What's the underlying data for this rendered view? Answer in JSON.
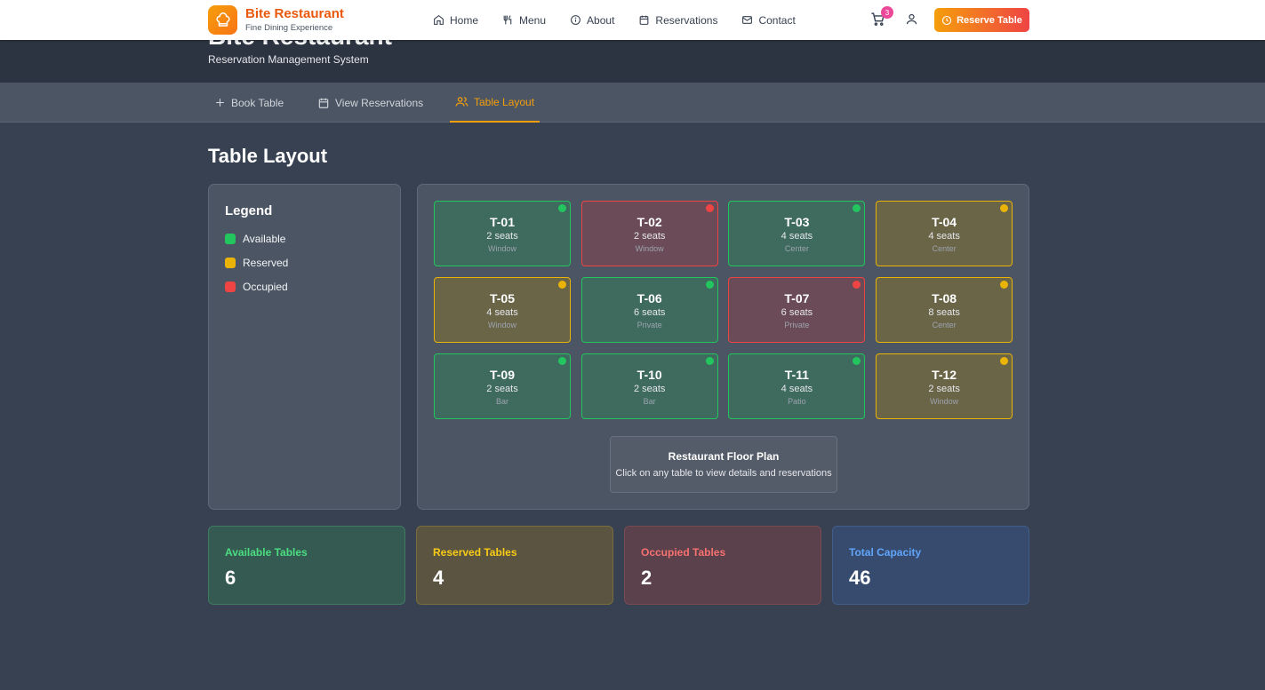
{
  "nav": {
    "brand_name": "Bite Restaurant",
    "brand_tagline": "Fine Dining Experience",
    "links": [
      {
        "label": "Home",
        "icon": "home-icon"
      },
      {
        "label": "Menu",
        "icon": "utensils-icon"
      },
      {
        "label": "About",
        "icon": "info-icon"
      },
      {
        "label": "Reservations",
        "icon": "calendar-icon"
      },
      {
        "label": "Contact",
        "icon": "mail-icon"
      }
    ],
    "cart_count": "3",
    "reserve_label": "Reserve Table"
  },
  "hero": {
    "title": "Bite Restaurant",
    "subtitle": "Reservation Management System"
  },
  "tabs": [
    {
      "label": "Book Table",
      "icon": "plus-icon"
    },
    {
      "label": "View Reservations",
      "icon": "calendar-icon"
    },
    {
      "label": "Table Layout",
      "icon": "users-icon"
    }
  ],
  "page_title": "Table Layout",
  "legend": {
    "title": "Legend",
    "items": [
      {
        "label": "Available",
        "color": "#22c55e"
      },
      {
        "label": "Reserved",
        "color": "#eab308"
      },
      {
        "label": "Occupied",
        "color": "#ef4444"
      }
    ]
  },
  "tables": [
    {
      "id": "T-01",
      "seats": "2 seats",
      "zone": "Window",
      "status": "available"
    },
    {
      "id": "T-02",
      "seats": "2 seats",
      "zone": "Window",
      "status": "occupied"
    },
    {
      "id": "T-03",
      "seats": "4 seats",
      "zone": "Center",
      "status": "available"
    },
    {
      "id": "T-04",
      "seats": "4 seats",
      "zone": "Center",
      "status": "reserved"
    },
    {
      "id": "T-05",
      "seats": "4 seats",
      "zone": "Window",
      "status": "reserved"
    },
    {
      "id": "T-06",
      "seats": "6 seats",
      "zone": "Private",
      "status": "available"
    },
    {
      "id": "T-07",
      "seats": "6 seats",
      "zone": "Private",
      "status": "occupied"
    },
    {
      "id": "T-08",
      "seats": "8 seats",
      "zone": "Center",
      "status": "reserved"
    },
    {
      "id": "T-09",
      "seats": "2 seats",
      "zone": "Bar",
      "status": "available"
    },
    {
      "id": "T-10",
      "seats": "2 seats",
      "zone": "Bar",
      "status": "available"
    },
    {
      "id": "T-11",
      "seats": "4 seats",
      "zone": "Patio",
      "status": "available"
    },
    {
      "id": "T-12",
      "seats": "2 seats",
      "zone": "Window",
      "status": "reserved"
    }
  ],
  "floorplan": {
    "title": "Restaurant Floor Plan",
    "subtitle": "Click on any table to view details and reservations"
  },
  "stats": [
    {
      "label": "Available Tables",
      "value": "6",
      "color": "#4ade80",
      "bg": "#355a52",
      "border": "#3f7a62"
    },
    {
      "label": "Reserved Tables",
      "value": "4",
      "color": "#facc15",
      "bg": "#5a5440",
      "border": "#7a6e3c"
    },
    {
      "label": "Occupied Tables",
      "value": "2",
      "color": "#f87171",
      "bg": "#5a414b",
      "border": "#7a4a52"
    },
    {
      "label": "Total Capacity",
      "value": "46",
      "color": "#60a5fa",
      "bg": "#374b6e",
      "border": "#435d8a"
    }
  ]
}
